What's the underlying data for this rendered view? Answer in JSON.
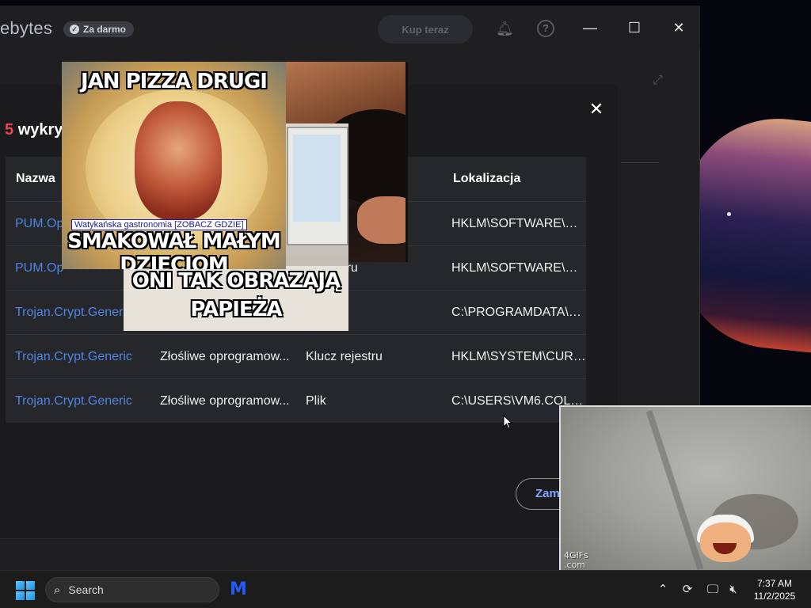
{
  "app": {
    "brand": "ebytes",
    "badge": "Za darmo",
    "buy_button": "Kup teraz",
    "window_controls": {
      "minimize": "—",
      "maximize": "☐",
      "close": "✕"
    }
  },
  "dialog": {
    "count": "5",
    "heading_text": "wykry",
    "close": "✕",
    "columns": [
      "Nazwa",
      "Lokalizacja"
    ],
    "rows": [
      {
        "name": "PUM.Op",
        "category": "",
        "type": "",
        "location": "HKLM\\SOFTWARE\\W..."
      },
      {
        "name": "PUM.Op",
        "category": "",
        "type": "c rejestru",
        "location": "HKLM\\SOFTWARE\\PO..."
      },
      {
        "name": "Trojan.Crypt.Generic",
        "category": "",
        "type": "",
        "location": "C:\\PROGRAMDATA\\G..."
      },
      {
        "name": "Trojan.Crypt.Generic",
        "category": "Złośliwe oprogramow...",
        "type": "Klucz rejestru",
        "location": "HKLM\\SYSTEM\\CURR..."
      },
      {
        "name": "Trojan.Crypt.Generic",
        "category": "Złośliwe oprogramow...",
        "type": "Plik",
        "location": "C:\\USERS\\VM6.COLL..."
      }
    ],
    "footer_button": "Zam"
  },
  "overlays": {
    "meme1_top": "JAN PIZZA DRUGI",
    "meme1_ad": "Watykańska gastronomia [ZOBACZ GDZIE]",
    "meme1_bottom": "SMAKOWAŁ MAŁYM DZIECIOM",
    "meme3_line1": "ONI TAK OBRAZAJĄ",
    "meme3_line2": "PAPIEŻA",
    "gif_watermark": "4GIFs\n.com"
  },
  "taskbar": {
    "search_placeholder": "Search",
    "time": "7:37 AM",
    "date": "11/2/2025",
    "app_icon": "M"
  }
}
